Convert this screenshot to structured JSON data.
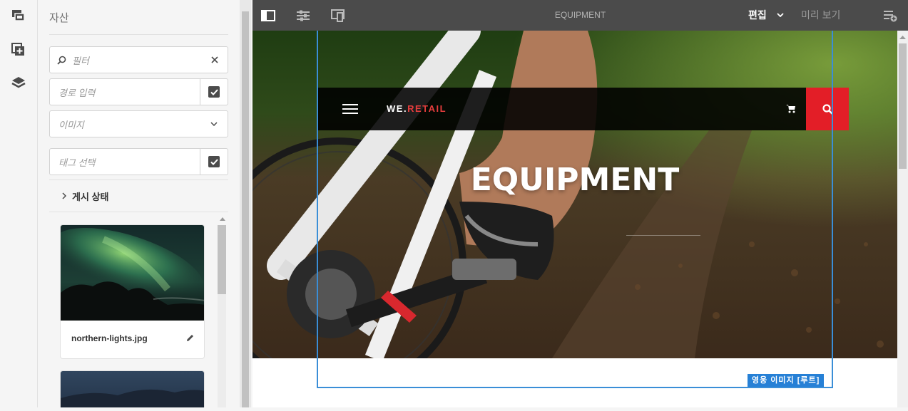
{
  "rail": {
    "items": [
      {
        "name": "assets-tab",
        "icon": "assets-icon"
      },
      {
        "name": "components-tab",
        "icon": "add-component-icon"
      },
      {
        "name": "content-tree-tab",
        "icon": "layers-icon"
      }
    ]
  },
  "panel": {
    "title": "자산",
    "filter_placeholder": "필터",
    "path_placeholder": "경로 입력",
    "type_select_value": "이미지",
    "tag_placeholder": "태그 선택",
    "publish_status_label": "게시 상태",
    "assets": [
      {
        "name": "northern-lights.jpg"
      },
      {
        "name": ""
      }
    ]
  },
  "toolbar": {
    "page_title": "EQUIPMENT",
    "edit_mode_label": "편집",
    "preview_label": "미리 보기"
  },
  "page": {
    "brand_prefix": "WE.",
    "brand_suffix": "RETAIL",
    "hero_title": "EQUIPMENT",
    "selection_label": "영웅 이미지 [루트]"
  },
  "colors": {
    "accent": "#e31e27",
    "selection": "#2680d6",
    "toolbar_bg": "#4b4b4b"
  }
}
